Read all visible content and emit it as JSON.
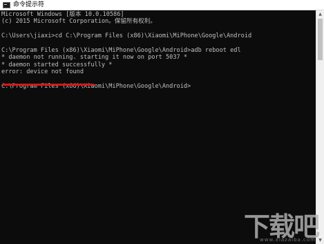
{
  "window": {
    "title": "命令提示符",
    "icon": "cmd-icon"
  },
  "console": {
    "lines": [
      "Microsoft Windows [版本 10.0.10586]",
      "(c) 2015 Microsoft Corporation。保留所有权利。",
      "",
      "C:\\Users\\jiaxi>cd C:\\Program Files (x86)\\Xiaomi\\MiPhone\\Google\\Android",
      "",
      "C:\\Program Files (x86)\\Xiaomi\\MiPhone\\Google\\Android>adb reboot edl",
      "* daemon not running. starting it now on port 5037 *",
      "* daemon started successfully *",
      "error: device not found",
      "",
      "C:\\Program Files (x86)\\Xiaomi\\MiPhone\\Google\\Android>"
    ]
  },
  "annotation": {
    "underline_color": "#d21a1a",
    "underlined_line": "error: device not found"
  },
  "watermark": {
    "text": "下载吧",
    "sub": "www.xiazaiba.com"
  },
  "colors": {
    "console_bg": "#0c0c0c",
    "console_text": "#c0c0c0",
    "titlebar_bg": "#ffffff"
  }
}
